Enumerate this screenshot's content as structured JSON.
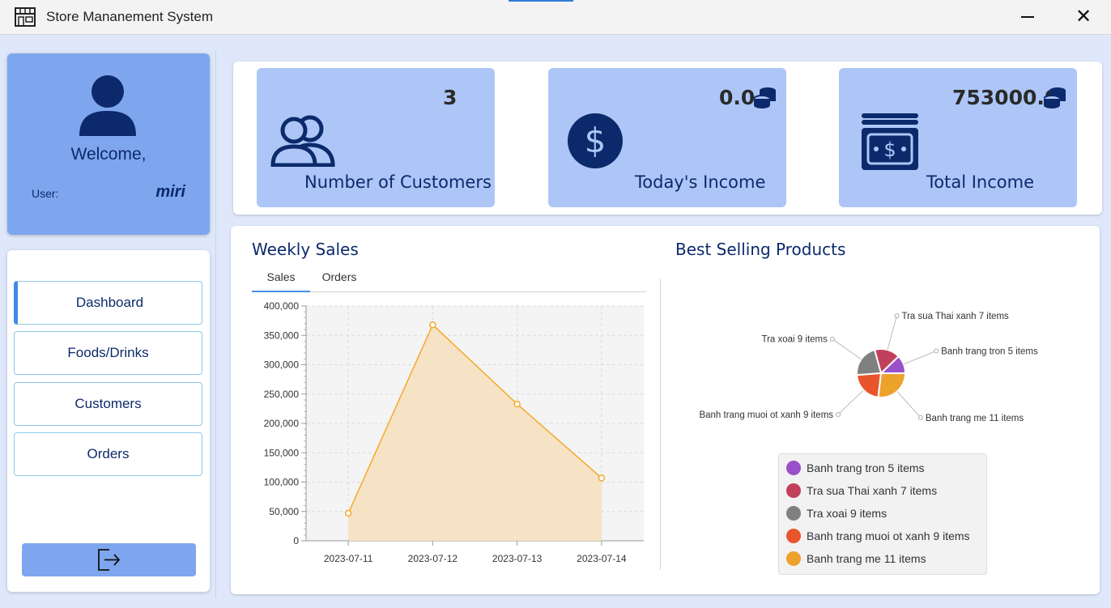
{
  "window": {
    "title": "Store Mananement System"
  },
  "profile": {
    "welcome": "Welcome,",
    "user_label": "User:",
    "user_name": "miri"
  },
  "nav": {
    "items": [
      {
        "label": "Dashboard",
        "active": true
      },
      {
        "label": "Foods/Drinks",
        "active": false
      },
      {
        "label": "Customers",
        "active": false
      },
      {
        "label": "Orders",
        "active": false
      }
    ]
  },
  "stats": {
    "customers": {
      "value": "3",
      "label": "Number of Customers"
    },
    "today_income": {
      "value": "0.0",
      "label": "Today's Income"
    },
    "total_income": {
      "value": "753000.0",
      "label": "Total Income"
    }
  },
  "weekly_sales": {
    "title": "Weekly Sales",
    "tabs": [
      "Sales",
      "Orders"
    ],
    "active_tab": "Sales"
  },
  "best_selling": {
    "title": "Best Selling Products"
  },
  "colors": {
    "accent": "#7ea6ee",
    "card": "#adc6f7",
    "navy": "#0c2a6b",
    "area_line": "#f4a92b",
    "area_fill": "#f6e1c0"
  },
  "chart_data": [
    {
      "type": "area",
      "title": "Weekly Sales",
      "x": [
        "2023-07-11",
        "2023-07-12",
        "2023-07-13",
        "2023-07-14"
      ],
      "values": [
        47000,
        368000,
        233000,
        107000
      ],
      "ylim": [
        0,
        400000
      ],
      "yticks": [
        "0",
        "50,000",
        "100,000",
        "150,000",
        "200,000",
        "250,000",
        "300,000",
        "350,000",
        "400,000"
      ],
      "grid": true,
      "xlabel": "",
      "ylabel": ""
    },
    {
      "type": "pie",
      "title": "Best Selling Products",
      "slices": [
        {
          "label": "Banh trang tron 5 items",
          "value": 5,
          "color": "#9b4fc9"
        },
        {
          "label": "Tra sua Thai xanh 7 items",
          "value": 7,
          "color": "#c2405c"
        },
        {
          "label": "Tra xoai 9 items",
          "value": 9,
          "color": "#808080"
        },
        {
          "label": "Banh trang muoi ot xanh 9 items",
          "value": 9,
          "color": "#e8552c"
        },
        {
          "label": "Banh trang me 11 items",
          "value": 11,
          "color": "#eda22c"
        }
      ],
      "legend_position": "bottom"
    }
  ]
}
